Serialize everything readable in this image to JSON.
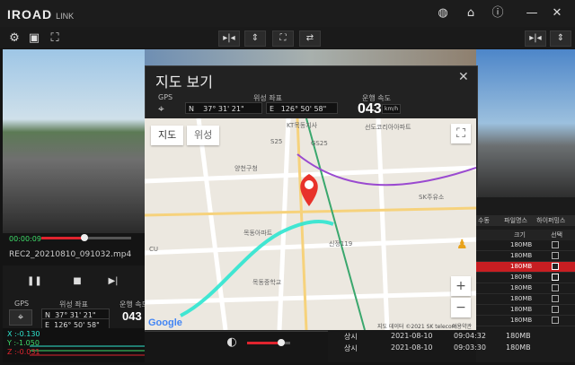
{
  "app": {
    "logo": "IROAD",
    "logo_sub": "LINK"
  },
  "topbar_icons": [
    "globe-icon",
    "home-icon",
    "info-icon",
    "minimize-icon",
    "close-icon"
  ],
  "toolbar": {
    "left_icons": [
      "gear-icon",
      "save-icon",
      "screenshot-icon"
    ],
    "center_icons": [
      "mirror-icon",
      "flip-icon",
      "fullscreen-icon",
      "swap-icon"
    ],
    "right_icons": [
      "mirror-icon",
      "flip-icon"
    ]
  },
  "player": {
    "time": "00:00:09",
    "filename": "REC2_20210810_091032.mp4",
    "progress": 0.46
  },
  "map_dialog": {
    "title": "지도 보기",
    "gps_label": "GPS",
    "coord_label": "위성 좌표",
    "speed_label": "운행 속도",
    "lat_dir": "N",
    "lat": "37° 31' 21\"",
    "lon_dir": "E",
    "lon": "126° 50' 58\"",
    "speed": "043",
    "speed_unit": "km/h",
    "tab_map": "지도",
    "tab_satellite": "위성",
    "google": "Google",
    "footer": "지도 데이터 ©2021 SK telecom",
    "footer2": "이용약관",
    "places": [
      "KT목동지사",
      "선도코리아아파트",
      "S25",
      "GS25",
      "양천구청",
      "SK주유소",
      "목동아파트",
      "CU",
      "신정119",
      "목동중학교"
    ]
  },
  "left_panel": {
    "gps_label": "GPS",
    "coord_label": "위성 좌표",
    "speed_label": "운행 속도",
    "lat_dir": "N",
    "lat": "37° 31' 21\"",
    "lon_dir": "E",
    "lon": "126° 50' 58\"",
    "speed": "043",
    "gsensor": {
      "x": "X :-0.130",
      "y": "Y :-1.050",
      "z": "Z :-0.031"
    }
  },
  "file_table": {
    "headers": [
      "수동",
      "파일명스",
      "하이퍼밍스"
    ],
    "sub_headers": [
      "크기",
      "선택"
    ],
    "rows": [
      {
        "size": "180MB",
        "checked": false,
        "selected": false
      },
      {
        "size": "180MB",
        "checked": false,
        "selected": false
      },
      {
        "size": "180MB",
        "checked": true,
        "selected": true
      },
      {
        "size": "180MB",
        "checked": true,
        "selected": false
      },
      {
        "size": "180MB",
        "checked": false,
        "selected": false
      },
      {
        "size": "180MB",
        "checked": false,
        "selected": false
      },
      {
        "size": "180MB",
        "checked": false,
        "selected": false
      },
      {
        "size": "180MB",
        "checked": false,
        "selected": false
      }
    ]
  },
  "event_list": [
    {
      "type": "상시",
      "date": "2021-08-10",
      "time": "09:04:32",
      "size": "180MB"
    },
    {
      "type": "상시",
      "date": "2021-08-10",
      "time": "09:03:30",
      "size": "180MB"
    }
  ],
  "colors": {
    "accent": "#e0242e",
    "route": "#2ee6d0"
  }
}
